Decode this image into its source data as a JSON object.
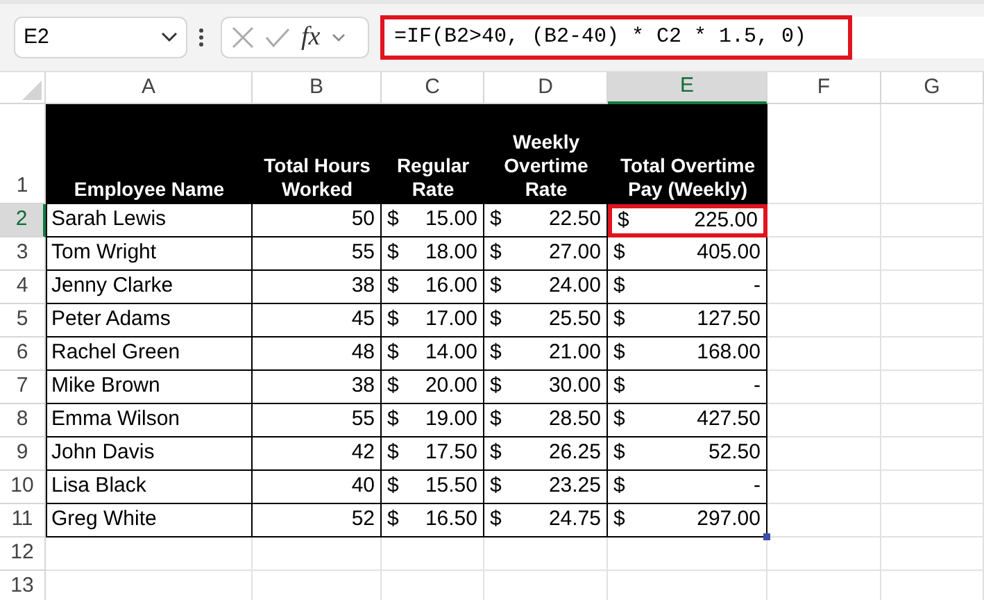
{
  "name_box": "E2",
  "function_label": "fx",
  "formula": {
    "text": "=IF(B2>40, (B2-40) * C2 * 1.5, 0)",
    "highlighted": true
  },
  "columns": [
    {
      "label": "A",
      "selected": false
    },
    {
      "label": "B",
      "selected": false
    },
    {
      "label": "C",
      "selected": false
    },
    {
      "label": "D",
      "selected": false
    },
    {
      "label": "E",
      "selected": true
    },
    {
      "label": "F",
      "selected": false
    },
    {
      "label": "G",
      "selected": false
    }
  ],
  "row_numbers": [
    {
      "label": "1",
      "selected": false
    },
    {
      "label": "2",
      "selected": true
    },
    {
      "label": "3",
      "selected": false
    },
    {
      "label": "4",
      "selected": false
    },
    {
      "label": "5",
      "selected": false
    },
    {
      "label": "6",
      "selected": false
    },
    {
      "label": "7",
      "selected": false
    },
    {
      "label": "8",
      "selected": false
    },
    {
      "label": "9",
      "selected": false
    },
    {
      "label": "10",
      "selected": false
    },
    {
      "label": "11",
      "selected": false
    },
    {
      "label": "12",
      "selected": false
    },
    {
      "label": "13",
      "selected": false
    }
  ],
  "table": {
    "headers": [
      "Employee Name",
      "Total Hours Worked",
      "Regular Rate",
      "Weekly Overtime Rate",
      "Total Overtime Pay (Weekly)"
    ],
    "rows": [
      {
        "name": "Sarah Lewis",
        "hours": "50",
        "rate": [
          "$",
          "15.00"
        ],
        "overtime_rate": [
          "$",
          "22.50"
        ],
        "overtime_pay": [
          "$",
          "225.00"
        ],
        "highlighted": true
      },
      {
        "name": "Tom Wright",
        "hours": "55",
        "rate": [
          "$",
          "18.00"
        ],
        "overtime_rate": [
          "$",
          "27.00"
        ],
        "overtime_pay": [
          "$",
          "405.00"
        ],
        "highlighted": false
      },
      {
        "name": "Jenny Clarke",
        "hours": "38",
        "rate": [
          "$",
          "16.00"
        ],
        "overtime_rate": [
          "$",
          "24.00"
        ],
        "overtime_pay": [
          "$",
          "-"
        ],
        "highlighted": false
      },
      {
        "name": "Peter Adams",
        "hours": "45",
        "rate": [
          "$",
          "17.00"
        ],
        "overtime_rate": [
          "$",
          "25.50"
        ],
        "overtime_pay": [
          "$",
          "127.50"
        ],
        "highlighted": false
      },
      {
        "name": "Rachel Green",
        "hours": "48",
        "rate": [
          "$",
          "14.00"
        ],
        "overtime_rate": [
          "$",
          "21.00"
        ],
        "overtime_pay": [
          "$",
          "168.00"
        ],
        "highlighted": false
      },
      {
        "name": "Mike Brown",
        "hours": "38",
        "rate": [
          "$",
          "20.00"
        ],
        "overtime_rate": [
          "$",
          "30.00"
        ],
        "overtime_pay": [
          "$",
          "-"
        ],
        "highlighted": false
      },
      {
        "name": "Emma Wilson",
        "hours": "55",
        "rate": [
          "$",
          "19.00"
        ],
        "overtime_rate": [
          "$",
          "28.50"
        ],
        "overtime_pay": [
          "$",
          "427.50"
        ],
        "highlighted": false
      },
      {
        "name": "John Davis",
        "hours": "42",
        "rate": [
          "$",
          "17.50"
        ],
        "overtime_rate": [
          "$",
          "26.25"
        ],
        "overtime_pay": [
          "$",
          "52.50"
        ],
        "highlighted": false
      },
      {
        "name": "Lisa Black",
        "hours": "40",
        "rate": [
          "$",
          "15.50"
        ],
        "overtime_rate": [
          "$",
          "23.25"
        ],
        "overtime_pay": [
          "$",
          "-"
        ],
        "highlighted": false
      },
      {
        "name": "Greg White",
        "hours": "52",
        "rate": [
          "$",
          "16.50"
        ],
        "overtime_rate": [
          "$",
          "24.75"
        ],
        "overtime_pay": [
          "$",
          "297.00"
        ],
        "highlighted": false
      }
    ]
  }
}
